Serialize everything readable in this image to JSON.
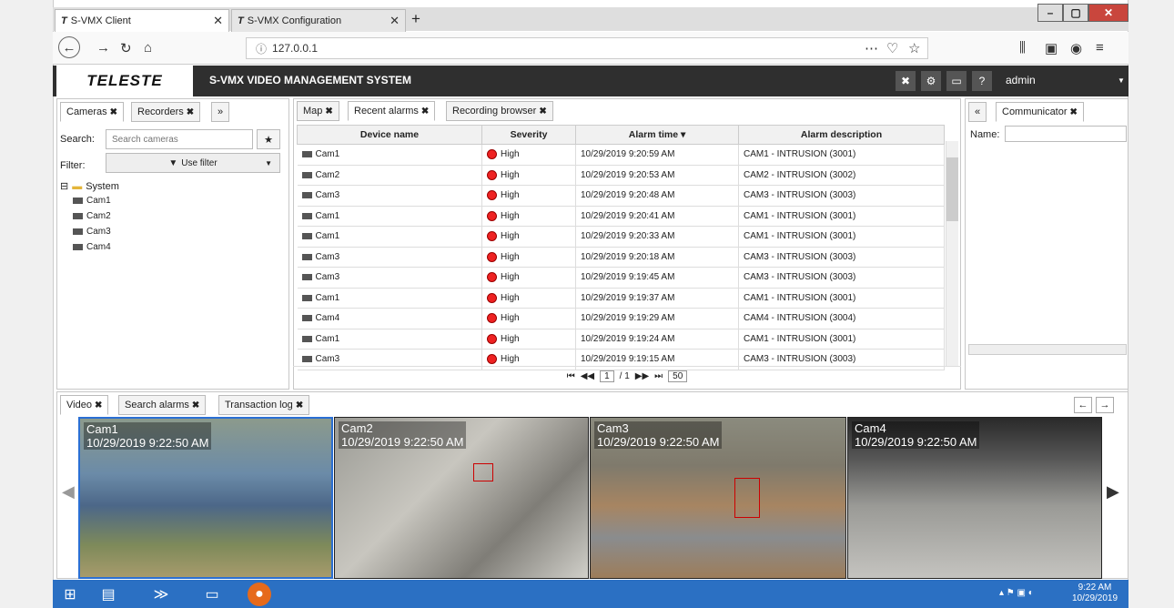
{
  "browser": {
    "tabs": [
      {
        "label": "S-VMX Client",
        "close": "✕",
        "active": true
      },
      {
        "label": "S-VMX Configuration",
        "close": "✕",
        "active": false
      }
    ],
    "new_tab": "+",
    "url": "127.0.0.1",
    "window_controls": [
      "–",
      "▢",
      "✕"
    ]
  },
  "app": {
    "logo": "TELESTE",
    "title": "S-VMX VIDEO MANAGEMENT SYSTEM",
    "user": "admin"
  },
  "left_panel": {
    "tabs": [
      {
        "label": "Cameras",
        "close": "✖"
      },
      {
        "label": "Recorders",
        "close": "✖"
      },
      {
        "label": "»",
        "close": ""
      }
    ],
    "search_label": "Search:",
    "search_placeholder": "Search cameras",
    "filter_label": "Filter:",
    "filter_value": "Use filter",
    "tree_root": "System",
    "tree_items": [
      "Cam1",
      "Cam2",
      "Cam3",
      "Cam4"
    ]
  },
  "center_panel": {
    "tabs": [
      {
        "label": "Map",
        "close": "✖"
      },
      {
        "label": "Recent alarms",
        "close": "✖"
      },
      {
        "label": "Recording browser",
        "close": "✖"
      }
    ],
    "columns": [
      "Device name",
      "Severity",
      "Alarm time ▾",
      "Alarm description"
    ],
    "rows": [
      {
        "device": "Cam1",
        "severity": "High",
        "time": "10/29/2019 9:20:59 AM",
        "desc": "CAM1 - INTRUSION (3001)"
      },
      {
        "device": "Cam2",
        "severity": "High",
        "time": "10/29/2019 9:20:53 AM",
        "desc": "CAM2 - INTRUSION (3002)"
      },
      {
        "device": "Cam3",
        "severity": "High",
        "time": "10/29/2019 9:20:48 AM",
        "desc": "CAM3 - INTRUSION (3003)"
      },
      {
        "device": "Cam1",
        "severity": "High",
        "time": "10/29/2019 9:20:41 AM",
        "desc": "CAM1 - INTRUSION (3001)"
      },
      {
        "device": "Cam1",
        "severity": "High",
        "time": "10/29/2019 9:20:33 AM",
        "desc": "CAM1 - INTRUSION (3001)"
      },
      {
        "device": "Cam3",
        "severity": "High",
        "time": "10/29/2019 9:20:18 AM",
        "desc": "CAM3 - INTRUSION (3003)"
      },
      {
        "device": "Cam3",
        "severity": "High",
        "time": "10/29/2019 9:19:45 AM",
        "desc": "CAM3 - INTRUSION (3003)"
      },
      {
        "device": "Cam1",
        "severity": "High",
        "time": "10/29/2019 9:19:37 AM",
        "desc": "CAM1 - INTRUSION (3001)"
      },
      {
        "device": "Cam4",
        "severity": "High",
        "time": "10/29/2019 9:19:29 AM",
        "desc": "CAM4 - INTRUSION (3004)"
      },
      {
        "device": "Cam1",
        "severity": "High",
        "time": "10/29/2019 9:19:24 AM",
        "desc": "CAM1 - INTRUSION (3001)"
      },
      {
        "device": "Cam3",
        "severity": "High",
        "time": "10/29/2019 9:19:15 AM",
        "desc": "CAM3 - INTRUSION (3003)"
      }
    ],
    "pager": {
      "first": "⏮",
      "prev": "◀◀",
      "page": "1",
      "of": "/ 1",
      "next": "▶▶",
      "last": "⏭",
      "page_size": "50"
    }
  },
  "right_panel": {
    "collapse": "«",
    "tab_label": "Communicator",
    "tab_close": "✖",
    "name_label": "Name:"
  },
  "bottom_panel": {
    "tabs": [
      {
        "label": "Video",
        "close": "✖"
      },
      {
        "label": "Search alarms",
        "close": "✖"
      },
      {
        "label": "Transaction log",
        "close": "✖"
      }
    ],
    "nav_prev": "←",
    "nav_next": "→",
    "videos": [
      {
        "name": "Cam1",
        "timestamp": "10/29/2019 9:22:50 AM"
      },
      {
        "name": "Cam2",
        "timestamp": "10/29/2019 9:22:50 AM"
      },
      {
        "name": "Cam3",
        "timestamp": "10/29/2019 9:22:50 AM"
      },
      {
        "name": "Cam4",
        "timestamp": "10/29/2019 9:22:50 AM"
      }
    ]
  },
  "taskbar": {
    "time": "9:22 AM",
    "date": "10/29/2019"
  }
}
